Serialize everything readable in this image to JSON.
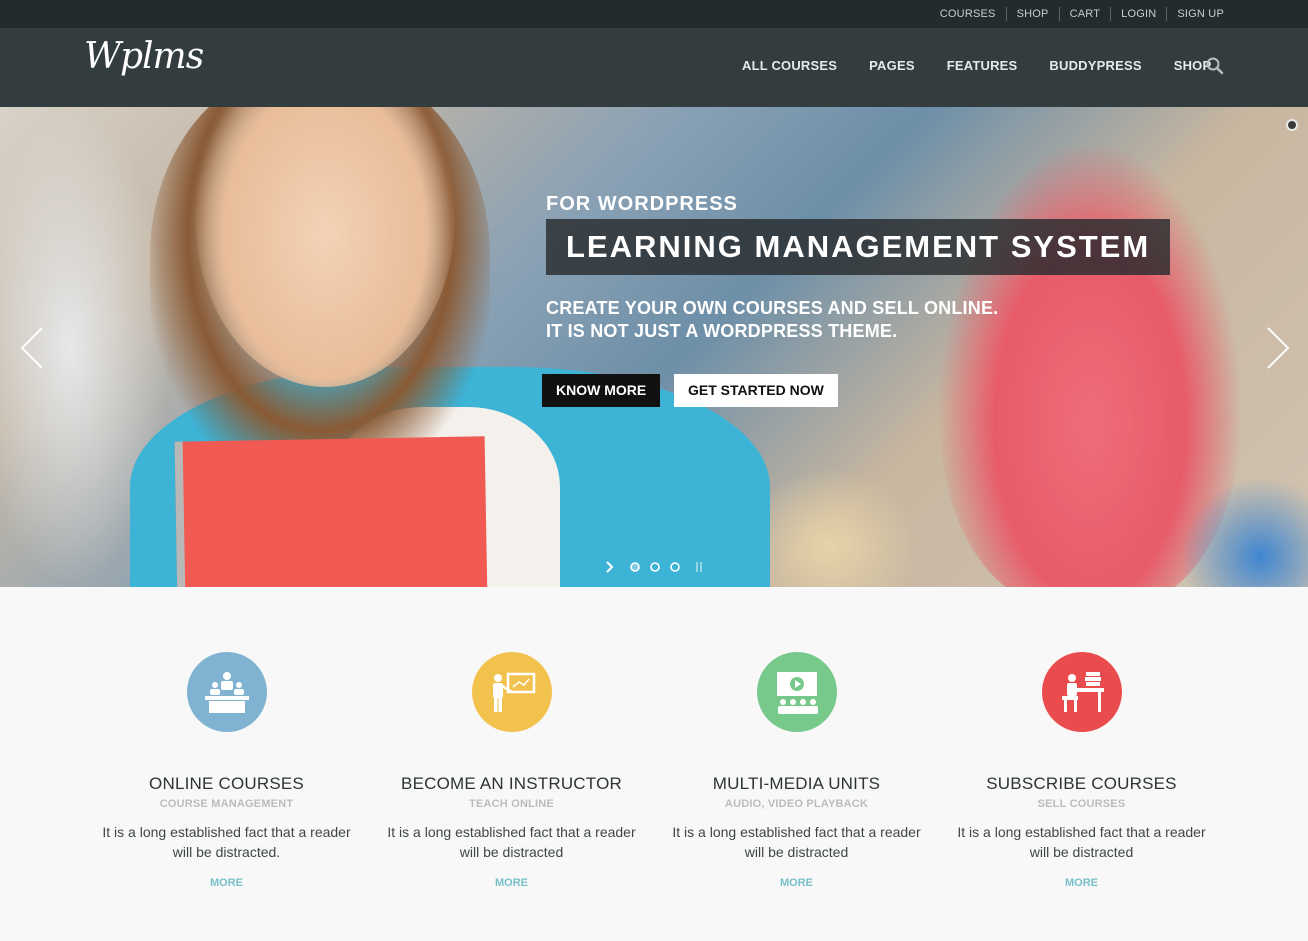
{
  "topbar": {
    "links": [
      "COURSES",
      "SHOP",
      "CART",
      "LOGIN",
      "SIGN UP"
    ]
  },
  "header": {
    "logo": "Wplms",
    "nav": [
      "ALL COURSES",
      "PAGES",
      "FEATURES",
      "BUDDYPRESS",
      "SHOP"
    ],
    "search_icon": "search-icon"
  },
  "hero": {
    "kicker": "FOR WORDPRESS",
    "title": "LEARNING MANAGEMENT SYSTEM",
    "subtitle_line1": "CREATE YOUR OWN COURSES AND SELL ONLINE.",
    "subtitle_line2": "IT IS NOT JUST A WORDPRESS THEME.",
    "primary_button": "KNOW MORE",
    "secondary_button": "GET STARTED NOW",
    "slide_count": 3,
    "active_slide": 1
  },
  "features": [
    {
      "title": "ONLINE COURSES",
      "subtitle": "COURSE MANAGEMENT",
      "description": "It is a long established fact that a reader will be distracted.",
      "more": "MORE",
      "color": "#7fb3d1",
      "icon": "classroom-icon"
    },
    {
      "title": "BECOME AN INSTRUCTOR",
      "subtitle": "TEACH ONLINE",
      "description": "It is a long established fact that a reader will be distracted",
      "more": "MORE",
      "color": "#f2c24f",
      "icon": "teacher-board-icon"
    },
    {
      "title": "MULTI-MEDIA UNITS",
      "subtitle": "AUDIO, VIDEO PLAYBACK",
      "description": "It is a long established fact that a reader will be distracted",
      "more": "MORE",
      "color": "#76c98a",
      "icon": "video-screen-icon"
    },
    {
      "title": "SUBSCRIBE COURSES",
      "subtitle": "SELL COURSES",
      "description": "It is a long established fact that a reader will be distracted",
      "more": "MORE",
      "color": "#ea4b4c",
      "icon": "student-desk-icon"
    }
  ]
}
